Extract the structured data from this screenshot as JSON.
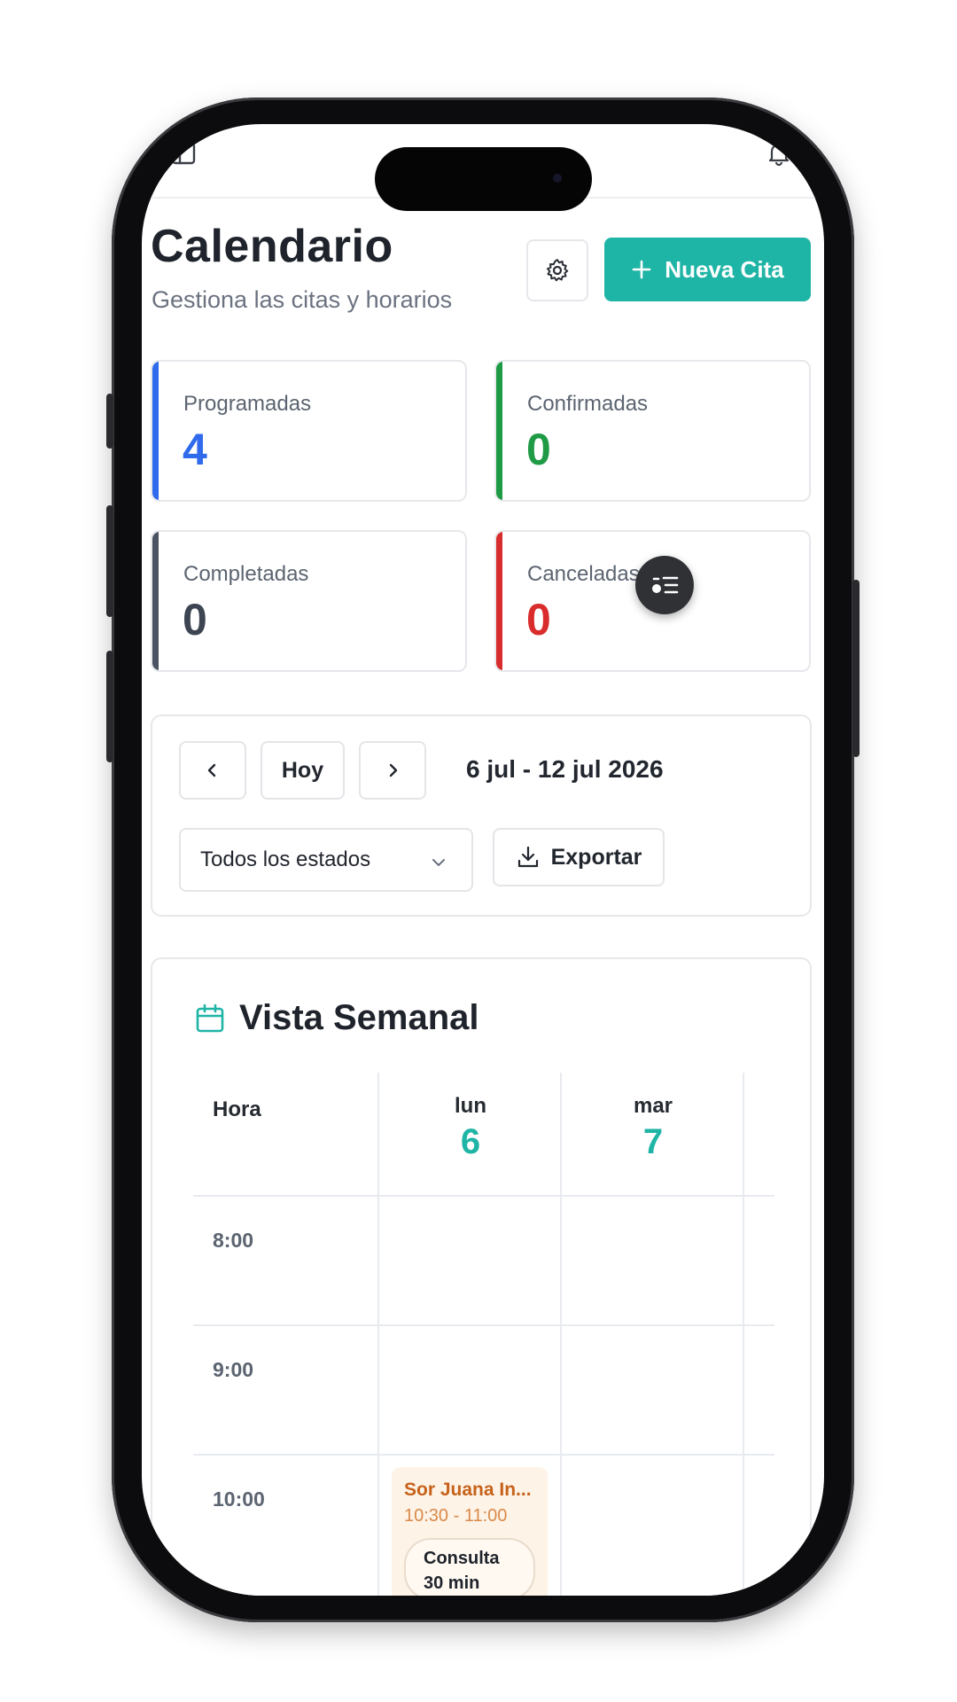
{
  "header": {
    "title": "Calendario",
    "subtitle": "Gestiona las citas y horarios",
    "new_button": "Nueva Cita"
  },
  "stats": [
    {
      "label": "Programadas",
      "value": "4",
      "color": "#2f6bec"
    },
    {
      "label": "Confirmadas",
      "value": "0",
      "color": "#1f9a45"
    },
    {
      "label": "Completadas",
      "value": "0",
      "color": "#4b5362"
    },
    {
      "label": "Canceladas",
      "value": "0",
      "color": "#d92d2d"
    }
  ],
  "navigation": {
    "today": "Hoy",
    "range": "6 jul - 12 jul 2026",
    "filter_value": "Todos los estados",
    "export": "Exportar"
  },
  "week": {
    "title": "Vista Semanal",
    "hour_header": "Hora",
    "days": [
      {
        "name": "lun",
        "date": "6"
      },
      {
        "name": "mar",
        "date": "7"
      }
    ],
    "times": [
      "8:00",
      "9:00",
      "10:00"
    ],
    "appointment": {
      "name": "Sor Juana In...",
      "time": "10:30 - 11:00",
      "type": "Consulta",
      "duration": "30 min"
    }
  },
  "colors": {
    "accent": "#1fb5a6",
    "appointment_text": "#c7621a"
  }
}
